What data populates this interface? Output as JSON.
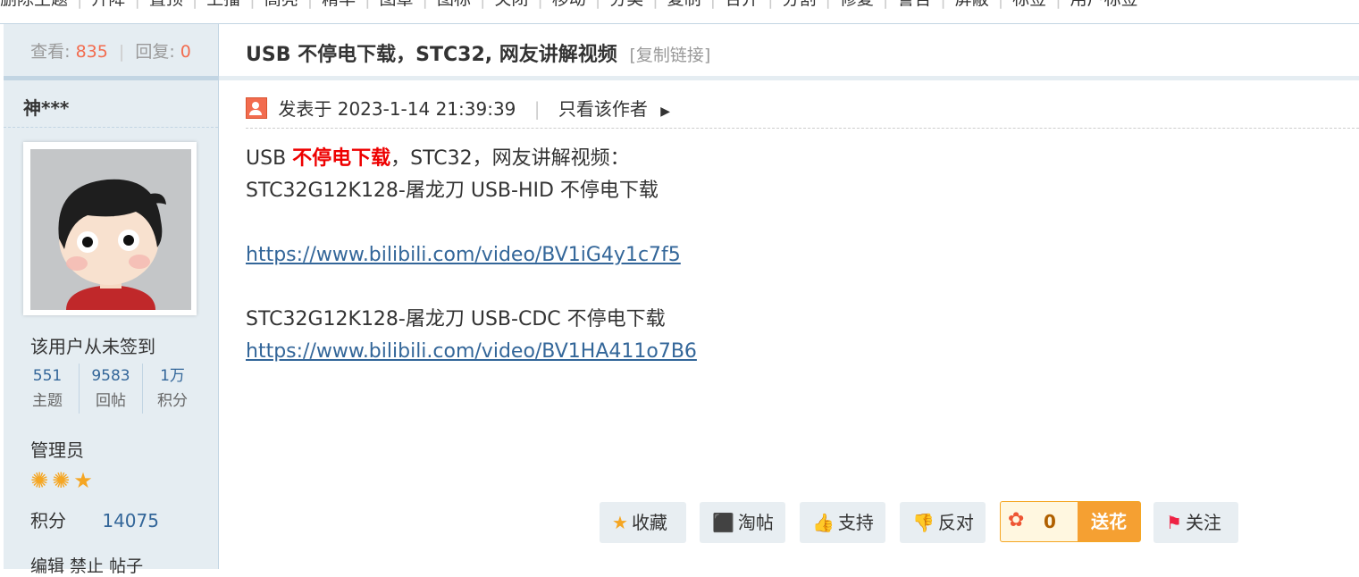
{
  "topnav": {
    "items": [
      "删除主题",
      "升降",
      "置顶",
      "上播",
      "高亮",
      "精华",
      "图章",
      "图标",
      "关闭",
      "移动",
      "分类",
      "复制",
      "合并",
      "分割",
      "修复",
      "警告",
      "屏蔽",
      "标签",
      "用户标签"
    ]
  },
  "thread": {
    "views_label": "查看:",
    "views": "835",
    "replies_label": "回复:",
    "replies": "0",
    "title": "USB 不停电下载，STC32, 网友讲解视频",
    "copy_link": "[复制链接]"
  },
  "author": {
    "name": "神***",
    "signin_status": "该用户从未签到",
    "stats": [
      {
        "value": "551",
        "label": "主题"
      },
      {
        "value": "9583",
        "label": "回帖"
      },
      {
        "value": "1万",
        "label": "积分"
      }
    ],
    "role": "管理员",
    "stars_icon": "star-icon",
    "points_label": "积分",
    "points_value": "14075",
    "edit_text": "编辑 禁止 帖子"
  },
  "post": {
    "posted_prefix": "发表于",
    "posted_time": "2023-1-14 21:39:39",
    "only_author": "只看该作者",
    "line1_pre": "USB ",
    "line1_red": "不停电下载",
    "line1_post": "，STC32，网友讲解视频：",
    "line2": "STC32G12K128-屠龙刀 USB-HID 不停电下载",
    "link1": "https://www.bilibili.com/video/BV1iG4y1c7f5",
    "line3": "STC32G12K128-屠龙刀 USB-CDC 不停电下载",
    "link2": "https://www.bilibili.com/video/BV1HA411o7B6"
  },
  "actions": {
    "favorite": "收藏",
    "taotie": "淘帖",
    "support": "支持",
    "oppose": "反对",
    "flower_count": "0",
    "send_flower": "送花",
    "follow": "关注"
  },
  "colors": {
    "accent_red": "#ee0000",
    "link_blue": "#336699",
    "count_orange": "#f26c4f",
    "sidebar_bg": "#e5edf2"
  }
}
